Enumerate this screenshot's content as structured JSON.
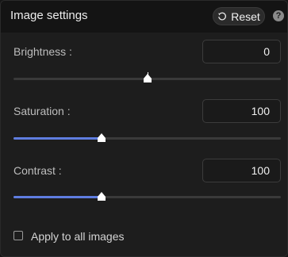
{
  "header": {
    "title": "Image settings",
    "reset_label": "Reset",
    "help_glyph": "?"
  },
  "sliders": [
    {
      "label": "Brightness :",
      "value": "0",
      "fraction": 0.5,
      "filled": false
    },
    {
      "label": "Saturation :",
      "value": "100",
      "fraction": 0.33,
      "filled": true
    },
    {
      "label": "Contrast :",
      "value": "100",
      "fraction": 0.33,
      "filled": true
    }
  ],
  "apply_all": {
    "label": "Apply to all images",
    "checked": false
  },
  "colors": {
    "accent": "#5f7de0",
    "track": "#3a3a3a",
    "panel": "#1d1d1d"
  },
  "icons": {
    "reset": "reset-icon",
    "help": "help-icon",
    "thumb": "slider-thumb-icon"
  }
}
